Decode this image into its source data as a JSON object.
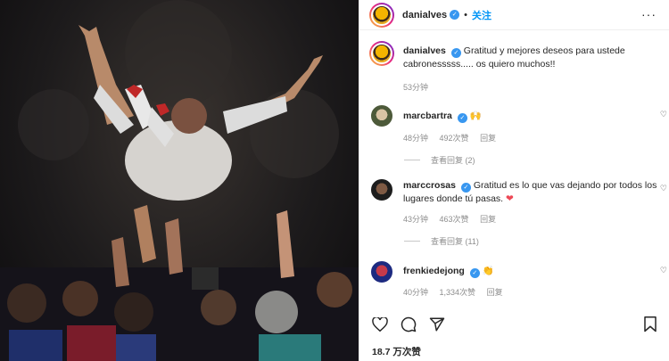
{
  "post": {
    "username": "danialves",
    "follow_label": "关注",
    "separator": "•",
    "more_label": "···"
  },
  "caption": {
    "username": "danialves",
    "text": "Gratitud y mejores deseos para ustede cabronesssss..... os quiero muchos!!",
    "time": "53分钟"
  },
  "comments": [
    {
      "username": "marcbartra",
      "text": "",
      "emoji": "🙌",
      "time": "48分钟",
      "likes": "492次赞",
      "reply_label": "回复",
      "view_replies": "查看回复 (2)"
    },
    {
      "username": "marccrosas",
      "text": "Gratitud es lo que vas dejando por todos los lugares donde tú pasas.",
      "emoji": "❤",
      "time": "43分钟",
      "likes": "463次赞",
      "reply_label": "回复",
      "view_replies": "查看回复 (11)"
    },
    {
      "username": "frenkiedejong",
      "text": "",
      "emoji": "👏",
      "time": "40分钟",
      "likes": "1,334次赞",
      "reply_label": "回复"
    }
  ],
  "footer": {
    "likes_count": "18.7 万次赞"
  },
  "colors": {
    "accent": "#0095f6",
    "verified": "#3897f0",
    "muted": "#8e8e8e",
    "heart_red": "#ed4956"
  },
  "icons": [
    "heart-icon",
    "comment-icon",
    "share-icon",
    "bookmark-icon",
    "verified-badge-icon",
    "more-icon"
  ]
}
